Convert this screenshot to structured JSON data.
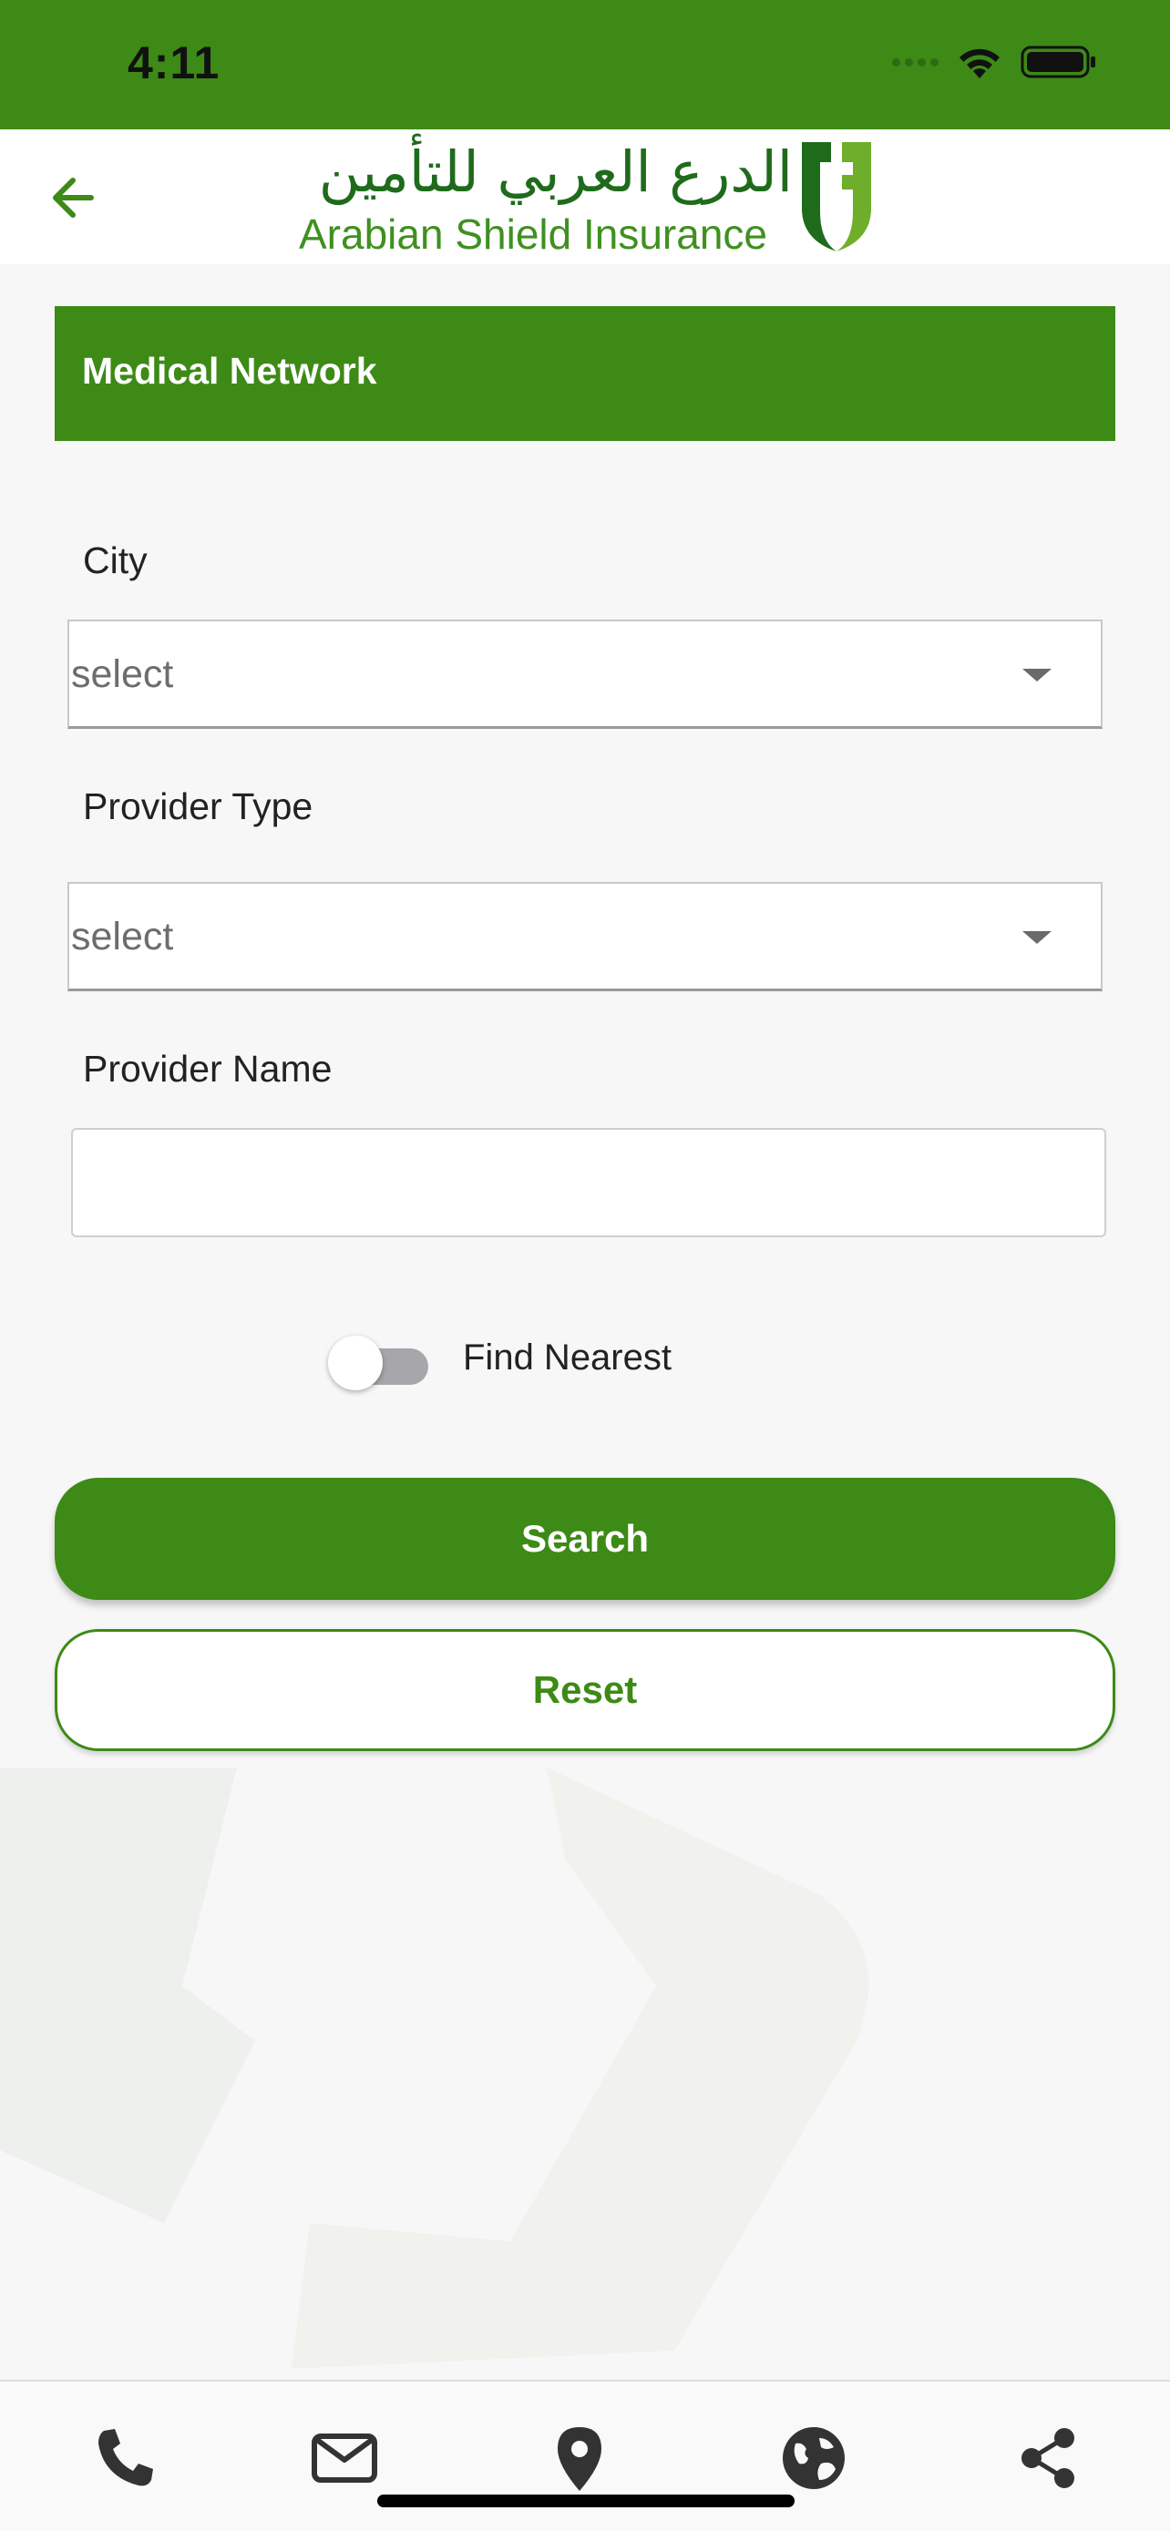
{
  "status_bar": {
    "time": "4:11"
  },
  "top_bar": {
    "logo_arabic": "الدرع العربي للتأمين",
    "logo_english": "Arabian Shield Insurance"
  },
  "header": {
    "title": "Medical Network"
  },
  "form": {
    "city": {
      "label": "City",
      "value": "select"
    },
    "provider_type": {
      "label": "Provider Type",
      "value": "select"
    },
    "provider_name": {
      "label": "Provider Name",
      "value": ""
    },
    "find_nearest": {
      "label": "Find Nearest",
      "enabled": false
    }
  },
  "buttons": {
    "search": "Search",
    "reset": "Reset"
  },
  "bottom_nav": {
    "items": [
      "phone-icon",
      "mail-icon",
      "location-pin-icon",
      "globe-icon",
      "share-icon"
    ]
  },
  "colors": {
    "brand_green": "#3d8a16",
    "logo_dark_green": "#1f6b1c"
  }
}
